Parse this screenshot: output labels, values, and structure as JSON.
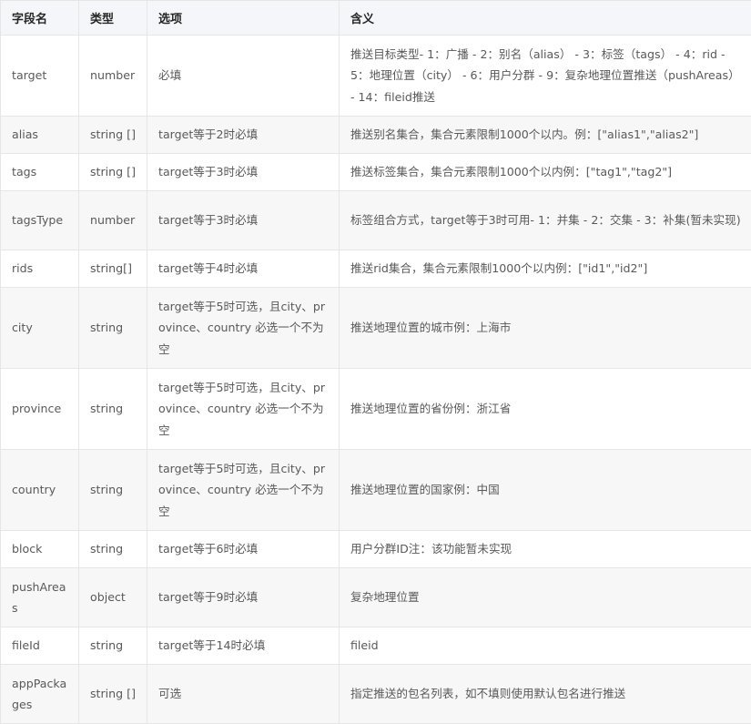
{
  "headers": [
    "字段名",
    "类型",
    "选项",
    "含义"
  ],
  "rows": [
    {
      "field": "target",
      "type": "number",
      "option": "必填",
      "meaning": "推送目标类型- 1：广播 - 2：别名（alias） - 3：标签（tags） - 4：rid - 5：地理位置（city） - 6：用户分群 - 9：复杂地理位置推送（pushAreas） - 14：fileid推送"
    },
    {
      "field": "alias",
      "type": "string []",
      "option": "target等于2时必填",
      "meaning": "推送别名集合，集合元素限制1000个以内。例：[\"alias1\",\"alias2\"]"
    },
    {
      "field": "tags",
      "type": "string []",
      "option": "target等于3时必填",
      "meaning": "推送标签集合，集合元素限制1000个以内例：[\"tag1\",\"tag2\"]"
    },
    {
      "field": "tagsType",
      "type": "number",
      "option": "target等于3时必填",
      "meaning": "标签组合方式，target等于3时可用- 1：并集 - 2：交集 - 3：补集(暂未实现)"
    },
    {
      "field": "rids",
      "type": "string[]",
      "option": "target等于4时必填",
      "meaning": "推送rid集合，集合元素限制1000个以内例：[\"id1\",\"id2\"]"
    },
    {
      "field": "city",
      "type": "string",
      "option": "target等于5时可选，且city、province、country 必选一个不为空",
      "meaning": "推送地理位置的城市例：上海市"
    },
    {
      "field": "province",
      "type": "string",
      "option": "target等于5时可选，且city、province、country 必选一个不为空",
      "meaning": "推送地理位置的省份例：浙江省"
    },
    {
      "field": "country",
      "type": "string",
      "option": "target等于5时可选，且city、province、country 必选一个不为空",
      "meaning": "推送地理位置的国家例：中国"
    },
    {
      "field": "block",
      "type": "string",
      "option": "target等于6时必填",
      "meaning": "用户分群ID注：该功能暂未实现"
    },
    {
      "field": "pushAreas",
      "type": "object",
      "option": "target等于9时必填",
      "meaning": "复杂地理位置"
    },
    {
      "field": "fileId",
      "type": "string",
      "option": "target等于14时必填",
      "meaning": "fileid"
    },
    {
      "field": "appPackages",
      "type": "string []",
      "option": "可选",
      "meaning": "指定推送的包名列表，如不填则使用默认包名进行推送"
    }
  ]
}
